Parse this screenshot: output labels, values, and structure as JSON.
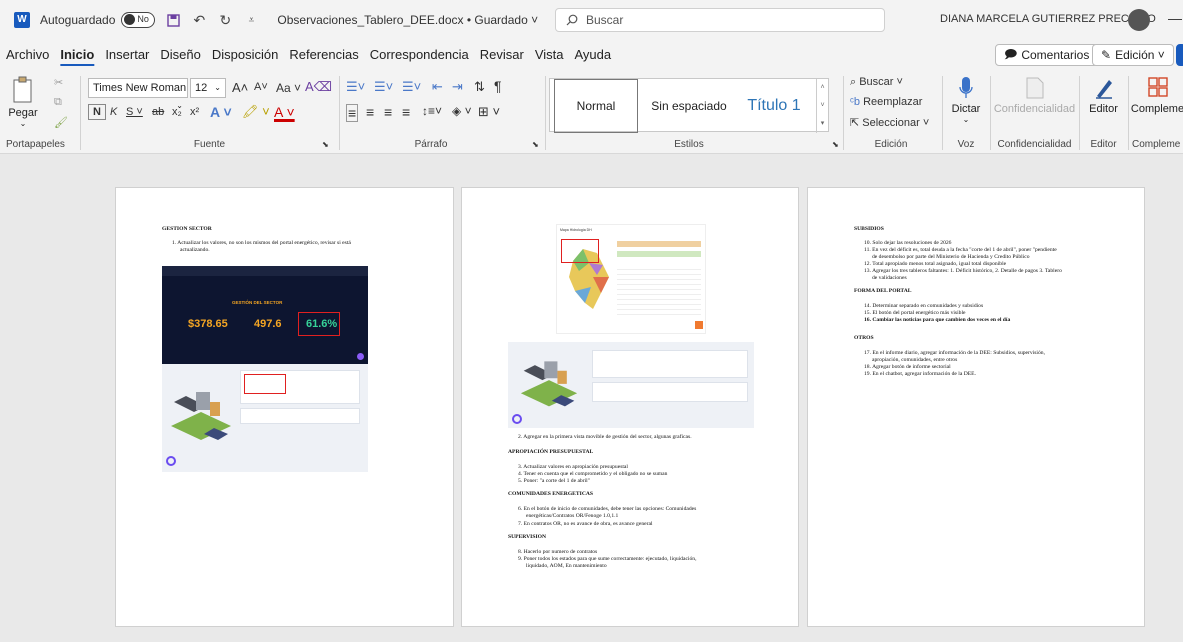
{
  "titlebar": {
    "autosave_label": "Autoguardado",
    "autosave_state": "No",
    "doc_title": "Observaciones_Tablero_DEE.docx • Guardado ˅",
    "search_placeholder": "Buscar",
    "user_name": "DIANA MARCELA GUTIERREZ PRECIADO",
    "minimize": "—"
  },
  "menu": [
    "Archivo",
    "Inicio",
    "Insertar",
    "Diseño",
    "Disposición",
    "Referencias",
    "Correspondencia",
    "Revisar",
    "Vista",
    "Ayuda"
  ],
  "menu_active": "Inicio",
  "menu_right": {
    "comments": "Comentarios",
    "editing": "Edición ˅"
  },
  "ribbon": {
    "portapapeles": {
      "paste": "Pegar",
      "label": "Portapapeles"
    },
    "fuente": {
      "font": "Times New Roman",
      "size": "12",
      "label": "Fuente"
    },
    "parrafo": {
      "label": "Párrafo"
    },
    "estilos": {
      "normal": "Normal",
      "sin_espaciado": "Sin espaciado",
      "titulo1": "Título 1",
      "label": "Estilos"
    },
    "edicion": {
      "buscar": "Buscar",
      "reemplazar": "Reemplazar",
      "seleccionar": "Seleccionar",
      "label": "Edición"
    },
    "voz": {
      "dictar": "Dictar",
      "label": "Voz"
    },
    "confidencialidad": {
      "button": "Confidencialidad",
      "label": "Confidencialidad"
    },
    "editor": {
      "button": "Editor",
      "label": "Editor"
    },
    "complementos": {
      "button": "Compleme",
      "label": "Compleme"
    }
  },
  "page1": {
    "heading": "GESTION SECTOR",
    "item1": "1.  Actualizar los valores, no son los mismos del portal energético, revisar si está",
    "item1b": "actualizando.",
    "screenshot_title": "GESTIÓN DEL SECTOR",
    "metrics": [
      "$378.65",
      "497.6",
      "61.6%"
    ]
  },
  "page2": {
    "chart_title": "Mapa Hidrología DH",
    "item2": "2.  Agregar en la primera vista movible de gestión del sector, algunas graficas.",
    "apropiacion": "APROPIACIÓN PRESUPUESTAL",
    "ap3": "3.  Actualizar valores en apropiación presupuestal",
    "ap4": "4.  Tener en cuenta que el comprometido y el obligado no se suman",
    "ap5": "5.  Poner: \"a corte del 1 de abril\"",
    "comunidades": "COMUNIDADES ENERGETICAS",
    "c6": "6.  En el botón de inicio de comunidades, debe tener las opciones: Comunidades",
    "c6b": "energéticas/Contratos OR/Fenoge 1.0,1.1",
    "c7": "7.  En contratos OR, no es avance de obra, es avance general",
    "supervision": "SUPERVISION",
    "s8": "8.  Hacerlo por numero de contratos",
    "s9": "9.  Poner todos los estados para que sume correctamente: ejecutado, liquidación,",
    "s9b": "liquidado, AOM, En mantenimiento"
  },
  "page3": {
    "subsidios": "SUBSIDIOS",
    "s10": "10. Solo dejar las resoluciones de 2026",
    "s11": "11. En vez del déficit es, total deuda a la fecha \"corte del 1 de abril\", poner \"pendiente",
    "s11b": "de desembolso por parte del Ministerio de Hacienda y Credito Público",
    "s12": "12. Total apropiado menos total asignado, igual total disponible",
    "s13": "13. Agregar los tres tableros faltantes: 1. Déficit histórico, 2. Detalle de pagos 3. Tablero",
    "s13b": "de validaciones",
    "forma": "FORMA DEL PORTAL",
    "f14": "14. Determinar separado en comunidades y subsidios",
    "f15": "15. El botón del portal energético más visible",
    "f16": "16. Cambiar las noticias para que cambien dos veces en el día",
    "otros": "OTROS",
    "o17": "17. En el informe diario, agregar información de la DEE: Subsidios, supervisión,",
    "o17b": "apropiación, comunidades, entre otros",
    "o18": "18. Agregar botón de informe sectorial",
    "o19": "19. En el chatbot, agregar información de la DEE."
  }
}
